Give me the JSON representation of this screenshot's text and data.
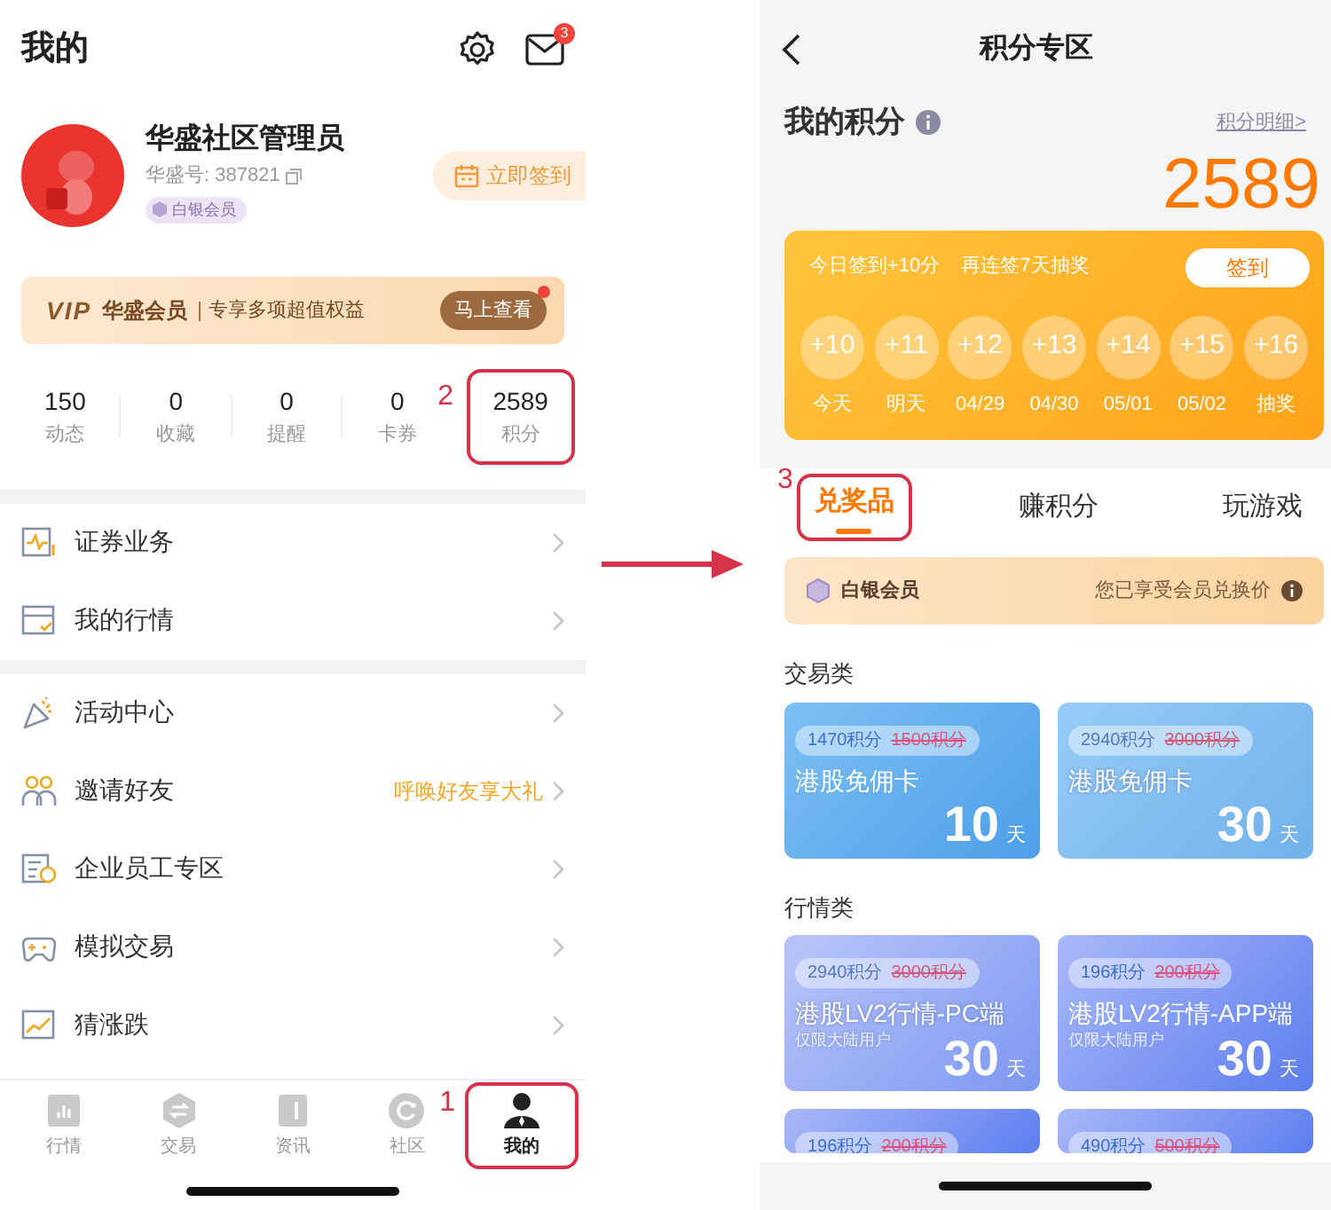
{
  "left_screen": {
    "title": "我的",
    "mail_badge": "3",
    "profile": {
      "name": "华盛社区管理员",
      "account": "华盛号: 387821",
      "level": "白银会员",
      "checkin_button": "立即签到"
    },
    "vip_banner": {
      "logo": "VIP",
      "brand": "华盛会员",
      "text": "专享多项超值权益",
      "button": "马上查看",
      "new_dot": true
    },
    "stats": [
      {
        "value": "150",
        "label": "动态",
        "highlighted": false
      },
      {
        "value": "0",
        "label": "收藏",
        "highlighted": false
      },
      {
        "value": "0",
        "label": "提醒",
        "highlighted": false
      },
      {
        "value": "0",
        "label": "卡券",
        "highlighted": false
      },
      {
        "value": "2589",
        "label": "积分",
        "highlighted": true,
        "step": "2"
      }
    ],
    "menu_groups": [
      [
        {
          "label": "证券业务"
        },
        {
          "label": "我的行情"
        }
      ],
      [
        {
          "label": "活动中心"
        },
        {
          "label": "邀请好友",
          "note": "呼唤好友享大礼"
        },
        {
          "label": "企业员工专区"
        },
        {
          "label": "模拟交易"
        },
        {
          "label": "猜涨跌"
        }
      ]
    ],
    "tab_bar": [
      {
        "label": "行情",
        "selected": false,
        "highlighted": false
      },
      {
        "label": "交易",
        "selected": false,
        "highlighted": false
      },
      {
        "label": "资讯",
        "selected": false,
        "highlighted": false
      },
      {
        "label": "社区",
        "selected": false,
        "highlighted": false
      },
      {
        "label": "我的",
        "selected": true,
        "highlighted": true,
        "step": "1"
      }
    ]
  },
  "right_screen": {
    "title": "积分专区",
    "points_title": "我的积分",
    "details_link": "积分明细>",
    "points": "2589",
    "checkin": {
      "today": "今日签到+10分",
      "streak": "再连签7天抽奖",
      "button": "签到",
      "days": [
        {
          "bonus": "+10",
          "label": "今天"
        },
        {
          "bonus": "+11",
          "label": "明天"
        },
        {
          "bonus": "+12",
          "label": "04/29"
        },
        {
          "bonus": "+13",
          "label": "04/30"
        },
        {
          "bonus": "+14",
          "label": "05/01"
        },
        {
          "bonus": "+15",
          "label": "05/02"
        },
        {
          "bonus": "+16",
          "label": "抽奖"
        }
      ]
    },
    "tabs": [
      {
        "label": "兑奖品",
        "selected": true,
        "highlighted": true,
        "step": "3"
      },
      {
        "label": "赚积分",
        "selected": false,
        "highlighted": false
      },
      {
        "label": "玩游戏",
        "selected": false,
        "highlighted": false
      }
    ],
    "member_bar": {
      "level": "白银会员",
      "text": "您已享受会员兑换价"
    },
    "sections": [
      {
        "title": "交易类",
        "items": [
          {
            "points": "1470积分",
            "original": "1500积分",
            "name": "港股免佣卡",
            "duration": "10",
            "unit": "天",
            "disabled": false
          },
          {
            "points": "2940积分",
            "original": "3000积分",
            "name": "港股免佣卡",
            "duration": "30",
            "unit": "天",
            "disabled": true
          }
        ]
      },
      {
        "title": "行情类",
        "items": [
          {
            "points": "2940积分",
            "original": "3000积分",
            "name": "港股LV2行情-PC端",
            "note": "仅限大陆用户",
            "duration": "30",
            "unit": "天",
            "disabled": true
          },
          {
            "points": "196积分",
            "original": "200积分",
            "name": "港股LV2行情-APP端",
            "note": "仅限大陆用户",
            "duration": "30",
            "unit": "天",
            "disabled": false
          },
          {
            "points": "196积分",
            "original": "200积分",
            "disabled": false
          },
          {
            "points": "490积分",
            "original": "500积分",
            "disabled": false
          }
        ]
      }
    ]
  }
}
